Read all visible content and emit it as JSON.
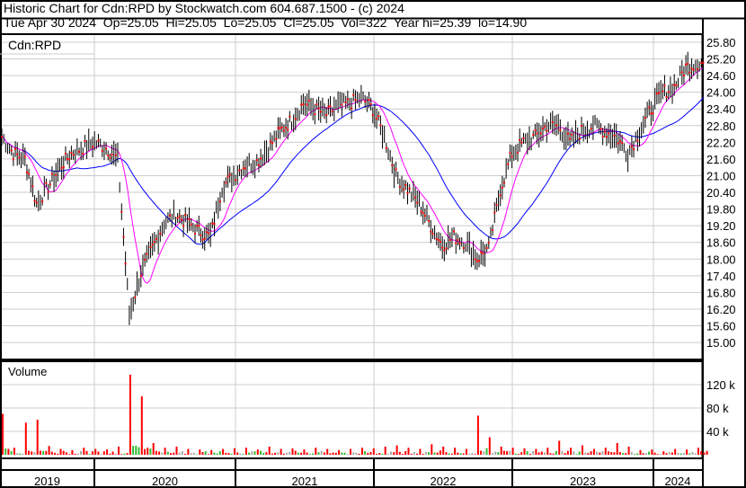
{
  "header": {
    "title": "Historic Chart for Cdn:RPD by Stockwatch.com 604.687.1500 - (c) 2024",
    "quote": "Tue Apr 30 2024  Op=25.05  Hi=25.05  Lo=25.05  Cl=25.05  Vol=322  Year hi=25.39  lo=14.90"
  },
  "chart_data": {
    "type": "line",
    "symbol_label": "Cdn:RPD",
    "volume_label": "Volume",
    "price_ticks": [
      "25.80",
      "25.20",
      "24.60",
      "24.00",
      "23.40",
      "22.80",
      "22.20",
      "21.60",
      "21.00",
      "20.40",
      "19.80",
      "19.20",
      "18.60",
      "18.00",
      "17.40",
      "16.80",
      "16.20",
      "15.60",
      "15.00"
    ],
    "price_range": [
      14.7,
      26.1
    ],
    "volume_ticks": [
      "120 k",
      "80 k",
      "40 k"
    ],
    "volume_range": [
      0,
      160000
    ],
    "years": [
      "2019",
      "2020",
      "2021",
      "2022",
      "2023",
      "2024"
    ],
    "start_month": "2019-04",
    "monthly_close": [
      22.4,
      21.8,
      21.6,
      20.0,
      20.6,
      21.3,
      21.8,
      22.0,
      22.2,
      22.0,
      21.6,
      16.0,
      17.5,
      18.4,
      19.3,
      19.6,
      19.3,
      19.0,
      18.8,
      20.6,
      21.0,
      21.4,
      21.5,
      22.0,
      22.6,
      23.0,
      23.6,
      23.4,
      23.2,
      23.5,
      23.6,
      23.8,
      23.4,
      22.4,
      21.0,
      20.5,
      20.0,
      19.2,
      18.5,
      18.8,
      18.6,
      18.0,
      18.4,
      20.5,
      21.8,
      22.2,
      22.4,
      22.8,
      22.8,
      22.2,
      22.6,
      22.8,
      22.6,
      22.4,
      21.8,
      22.6,
      23.4,
      24.0,
      24.2,
      24.9,
      25.05
    ],
    "monthly_peak_volume": [
      70000,
      12000,
      55000,
      60000,
      15000,
      10000,
      8000,
      12000,
      10000,
      9000,
      14000,
      137000,
      100000,
      20000,
      12000,
      14000,
      10000,
      9000,
      8000,
      10000,
      11000,
      12000,
      9000,
      14000,
      10000,
      11000,
      9000,
      12000,
      10000,
      8000,
      10000,
      12000,
      11000,
      14000,
      16000,
      12000,
      10000,
      18000,
      14000,
      12000,
      10000,
      67000,
      30000,
      14000,
      12000,
      11000,
      10000,
      12000,
      24000,
      12000,
      16000,
      10000,
      12000,
      20000,
      14000,
      8000,
      9000,
      6000,
      10000,
      9000,
      12000
    ],
    "series": [
      {
        "name": "Price",
        "color": "#000000"
      },
      {
        "name": "Short MA",
        "color": "#ff00ff"
      },
      {
        "name": "Long MA",
        "color": "#0000ff"
      }
    ]
  }
}
